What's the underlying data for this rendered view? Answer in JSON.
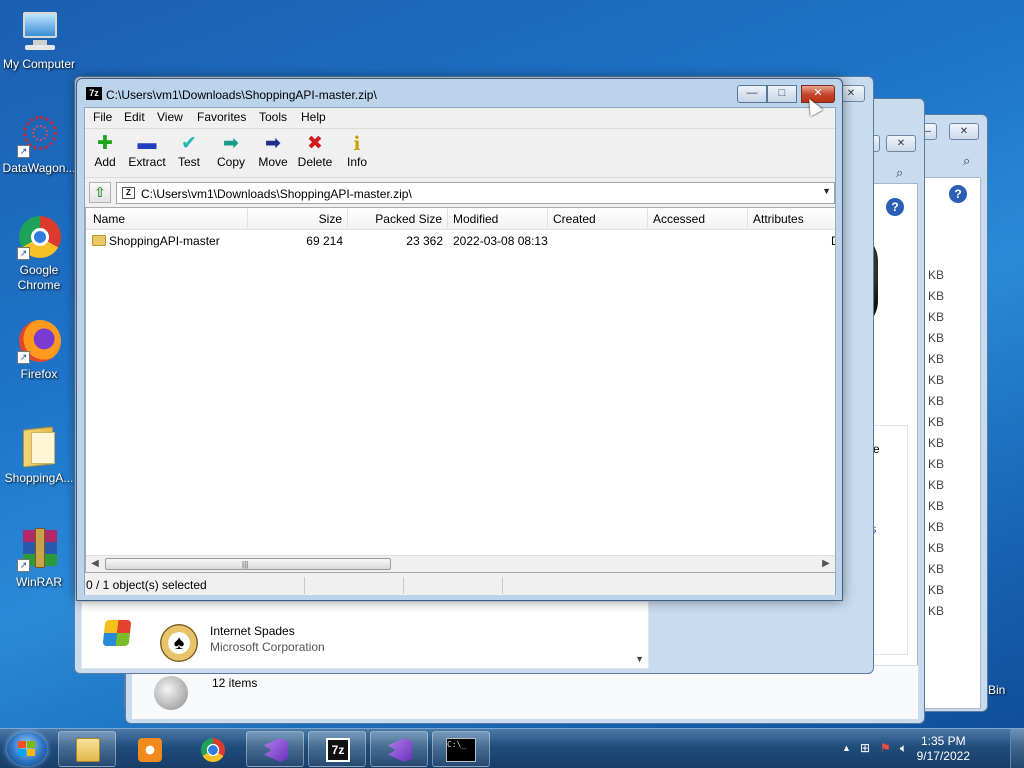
{
  "desktop": {
    "icons": [
      {
        "label": "My Computer",
        "icon": "computer-icon"
      },
      {
        "label": "DataWagon...",
        "icon": "datawagon-icon"
      },
      {
        "label": "Google Chrome",
        "icon": "chrome-icon"
      },
      {
        "label": "Firefox",
        "icon": "firefox-icon"
      },
      {
        "label": "ShoppingA...",
        "icon": "folder-icon"
      },
      {
        "label": "WinRAR",
        "icon": "winrar-icon"
      }
    ],
    "recycle_fragment": "Bin"
  },
  "bg_windows": {
    "list_items": [
      {
        "title": "Internet Spades",
        "subtitle": "Microsoft Corporation"
      }
    ],
    "status": "12 items",
    "kb_label": "KB",
    "kb_rows": 17,
    "side_text_1": "ormance",
    "side_text_2": "cores"
  },
  "zip_window": {
    "title": "C:\\Users\\vm1\\Downloads\\ShoppingAPI-master.zip\\",
    "minimize_glyph": "—",
    "maximize_glyph": "□",
    "close_glyph": "✕",
    "menu": [
      "File",
      "Edit",
      "View",
      "Favorites",
      "Tools",
      "Help"
    ],
    "toolbar": [
      {
        "label": "Add",
        "icon": "add-icon",
        "glyph": "✚",
        "color": "#1aa51a"
      },
      {
        "label": "Extract",
        "icon": "extract-icon",
        "glyph": "▬",
        "color": "#1e3fbf"
      },
      {
        "label": "Test",
        "icon": "test-icon",
        "glyph": "✔",
        "color": "#1fb6b6"
      },
      {
        "label": "Copy",
        "icon": "copy-icon",
        "glyph": "➡",
        "color": "#1a9a8a"
      },
      {
        "label": "Move",
        "icon": "move-icon",
        "glyph": "➡",
        "color": "#1b2f8f"
      },
      {
        "label": "Delete",
        "icon": "delete-icon",
        "glyph": "✖",
        "color": "#d11a1a"
      },
      {
        "label": "Info",
        "icon": "info-icon",
        "glyph": "i",
        "color": "#c9a400"
      }
    ],
    "address": "C:\\Users\\vm1\\Downloads\\ShoppingAPI-master.zip\\",
    "columns": [
      "Name",
      "Size",
      "Packed Size",
      "Modified",
      "Created",
      "Accessed",
      "Attributes"
    ],
    "rows": [
      {
        "name": "ShoppingAPI-master",
        "size": "69 214",
        "packed": "23 362",
        "modified": "2022-03-08 08:13",
        "created": "",
        "accessed": "",
        "attributes": "D"
      }
    ],
    "status": "0 / 1 object(s) selected"
  },
  "taskbar": {
    "time": "1:35 PM",
    "date": "9/17/2022",
    "pinned": [
      "explorer",
      "media-player",
      "chrome",
      "visual-studio",
      "7zip",
      "visual-studio-installer",
      "cmd"
    ]
  }
}
